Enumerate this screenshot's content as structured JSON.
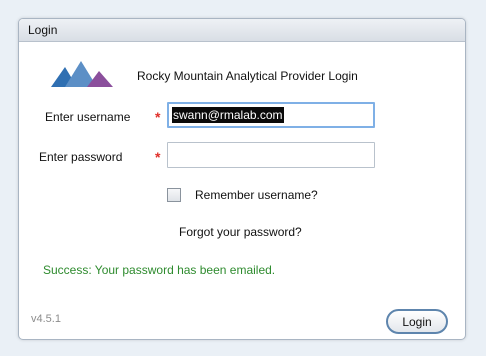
{
  "window": {
    "title": "Login"
  },
  "brand": {
    "title": "Rocky Mountain Analytical Provider Login",
    "logo_colors": [
      "#2f6fb2",
      "#5c8fc6",
      "#8b4f9c"
    ]
  },
  "form": {
    "username_label": "Enter username",
    "username_value": "swann@rmalab.com",
    "password_label": "Enter password",
    "password_value": "",
    "required_mark": "*",
    "remember_label": "Remember username?",
    "remember_checked": false,
    "forgot_label": "Forgot your password?"
  },
  "status": {
    "message": "Success: Your password has been emailed.",
    "color": "#2e8b2e"
  },
  "footer": {
    "version": "v4.5.1",
    "login_label": "Login"
  }
}
